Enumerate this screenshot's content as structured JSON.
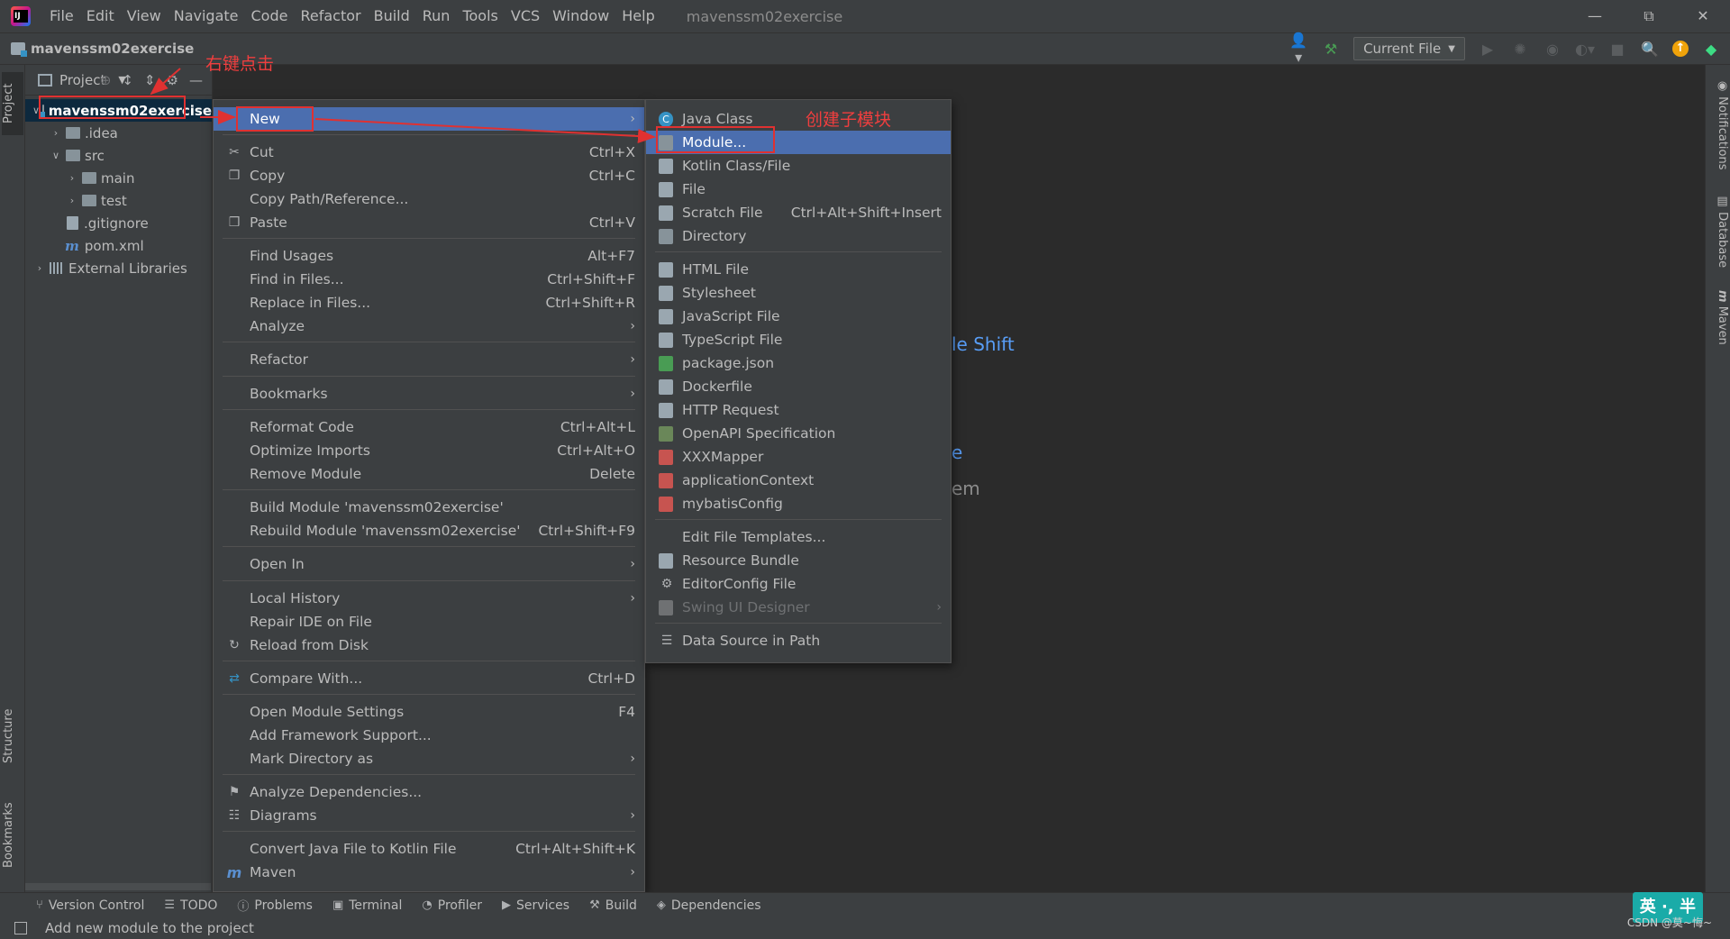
{
  "menubar": {
    "items": [
      "File",
      "Edit",
      "View",
      "Navigate",
      "Code",
      "Refactor",
      "Build",
      "Run",
      "Tools",
      "VCS",
      "Window",
      "Help"
    ],
    "window_title": "mavenssm02exercise"
  },
  "navbar": {
    "project_name": "mavenssm02exercise",
    "run_config": "Current File"
  },
  "project_panel": {
    "title": "Project",
    "tree": [
      {
        "label": "mavenssm02exercise",
        "level": 0,
        "type": "module",
        "expanded": true,
        "selected": true
      },
      {
        "label": ".idea",
        "level": 1,
        "type": "folder",
        "expanded": false
      },
      {
        "label": "src",
        "level": 1,
        "type": "folder",
        "expanded": true
      },
      {
        "label": "main",
        "level": 2,
        "type": "folder",
        "expanded": false
      },
      {
        "label": "test",
        "level": 2,
        "type": "folder",
        "expanded": false
      },
      {
        "label": ".gitignore",
        "level": 1,
        "type": "file"
      },
      {
        "label": "pom.xml",
        "level": 1,
        "type": "maven"
      },
      {
        "label": "External Libraries",
        "level": 0,
        "type": "library",
        "expanded": false
      }
    ]
  },
  "left_strip": {
    "project": "Project",
    "structure": "Structure",
    "bookmarks": "Bookmarks"
  },
  "right_strip": {
    "notifications": "Notifications",
    "database": "Database",
    "maven": "Maven"
  },
  "editor_hints": {
    "partial_1": "le Shift",
    "partial_2": "e",
    "partial_3": "em"
  },
  "context_menu": {
    "items": [
      {
        "label": "New",
        "shortcut": "",
        "submenu": true,
        "selected": true,
        "icon": ""
      },
      {
        "label": "Cut",
        "shortcut": "Ctrl+X",
        "icon": "scissors-icon"
      },
      {
        "label": "Copy",
        "shortcut": "Ctrl+C",
        "icon": "copy-icon"
      },
      {
        "label": "Copy Path/Reference...",
        "shortcut": ""
      },
      {
        "label": "Paste",
        "shortcut": "Ctrl+V",
        "icon": "paste-icon"
      },
      {
        "label": "Find Usages",
        "shortcut": "Alt+F7"
      },
      {
        "label": "Find in Files...",
        "shortcut": "Ctrl+Shift+F"
      },
      {
        "label": "Replace in Files...",
        "shortcut": "Ctrl+Shift+R"
      },
      {
        "label": "Analyze",
        "shortcut": "",
        "submenu": true
      },
      {
        "label": "Refactor",
        "shortcut": "",
        "submenu": true
      },
      {
        "label": "Bookmarks",
        "shortcut": "",
        "submenu": true
      },
      {
        "label": "Reformat Code",
        "shortcut": "Ctrl+Alt+L"
      },
      {
        "label": "Optimize Imports",
        "shortcut": "Ctrl+Alt+O"
      },
      {
        "label": "Remove Module",
        "shortcut": "Delete"
      },
      {
        "label": "Build Module 'mavenssm02exercise'",
        "shortcut": ""
      },
      {
        "label": "Rebuild Module 'mavenssm02exercise'",
        "shortcut": "Ctrl+Shift+F9"
      },
      {
        "label": "Open In",
        "shortcut": "",
        "submenu": true
      },
      {
        "label": "Local History",
        "shortcut": "",
        "submenu": true
      },
      {
        "label": "Repair IDE on File",
        "shortcut": ""
      },
      {
        "label": "Reload from Disk",
        "shortcut": "",
        "icon": "reload-icon"
      },
      {
        "label": "Compare With...",
        "shortcut": "Ctrl+D",
        "icon": "compare-icon"
      },
      {
        "label": "Open Module Settings",
        "shortcut": "F4"
      },
      {
        "label": "Add Framework Support...",
        "shortcut": ""
      },
      {
        "label": "Mark Directory as",
        "shortcut": "",
        "submenu": true
      },
      {
        "label": "Analyze Dependencies...",
        "shortcut": "",
        "icon": "dependencies-icon"
      },
      {
        "label": "Diagrams",
        "shortcut": "",
        "submenu": true,
        "icon": "diagram-icon"
      },
      {
        "label": "Convert Java File to Kotlin File",
        "shortcut": "Ctrl+Alt+Shift+K"
      },
      {
        "label": "Maven",
        "shortcut": "",
        "submenu": true,
        "icon": "maven-icon"
      }
    ]
  },
  "new_submenu": {
    "items": [
      {
        "label": "Java Class",
        "shortcut": "",
        "icon": "java-class-icon",
        "color": "#3592c4"
      },
      {
        "label": "Module...",
        "shortcut": "",
        "icon": "module-icon",
        "color": "#87939a",
        "selected": true
      },
      {
        "label": "Kotlin Class/File",
        "shortcut": "",
        "icon": "kotlin-icon",
        "color": "#9aa7b0"
      },
      {
        "label": "File",
        "shortcut": "",
        "icon": "file-icon",
        "color": "#9aa7b0"
      },
      {
        "label": "Scratch File",
        "shortcut": "Ctrl+Alt+Shift+Insert",
        "icon": "scratch-file-icon",
        "color": "#9aa7b0"
      },
      {
        "label": "Directory",
        "shortcut": "",
        "icon": "folder-icon",
        "color": "#87939a"
      },
      {
        "label": "HTML File",
        "shortcut": "",
        "icon": "html-file-icon",
        "color": "#9aa7b0"
      },
      {
        "label": "Stylesheet",
        "shortcut": "",
        "icon": "css-file-icon",
        "color": "#9aa7b0"
      },
      {
        "label": "JavaScript File",
        "shortcut": "",
        "icon": "js-file-icon",
        "color": "#9aa7b0"
      },
      {
        "label": "TypeScript File",
        "shortcut": "",
        "icon": "ts-file-icon",
        "color": "#9aa7b0"
      },
      {
        "label": "package.json",
        "shortcut": "",
        "icon": "npm-icon",
        "color": "#499c54"
      },
      {
        "label": "Dockerfile",
        "shortcut": "",
        "icon": "docker-icon",
        "color": "#9aa7b0"
      },
      {
        "label": "HTTP Request",
        "shortcut": "",
        "icon": "http-request-icon",
        "color": "#9aa7b0"
      },
      {
        "label": "OpenAPI Specification",
        "shortcut": "",
        "icon": "openapi-icon",
        "color": "#6a8759"
      },
      {
        "label": "XXXMapper",
        "shortcut": "",
        "icon": "xml-template-icon",
        "color": "#c75450"
      },
      {
        "label": "applicationContext",
        "shortcut": "",
        "icon": "xml-template-icon",
        "color": "#c75450"
      },
      {
        "label": "mybatisConfig",
        "shortcut": "",
        "icon": "xml-template-icon",
        "color": "#c75450"
      },
      {
        "label": "Edit File Templates...",
        "shortcut": ""
      },
      {
        "label": "Resource Bundle",
        "shortcut": "",
        "icon": "resource-bundle-icon",
        "color": "#9aa7b0"
      },
      {
        "label": "EditorConfig File",
        "shortcut": "",
        "icon": "gear-icon",
        "color": "#9aa7b0"
      },
      {
        "label": "Swing UI Designer",
        "shortcut": "",
        "submenu": true,
        "disabled": true,
        "icon": "swing-icon",
        "color": "#6f7173"
      },
      {
        "label": "Data Source in Path",
        "shortcut": "",
        "icon": "database-icon",
        "color": "#9aa7b0"
      }
    ]
  },
  "bottom_tools": [
    "Version Control",
    "TODO",
    "Problems",
    "Terminal",
    "Profiler",
    "Services",
    "Build",
    "Dependencies"
  ],
  "status_text": "Add new module to the project",
  "ime": "英 ·, 半",
  "watermark": "CSDN @莫~悔~",
  "annotations": {
    "right_click": "右键点击",
    "create_submodule": "创建子模块"
  }
}
